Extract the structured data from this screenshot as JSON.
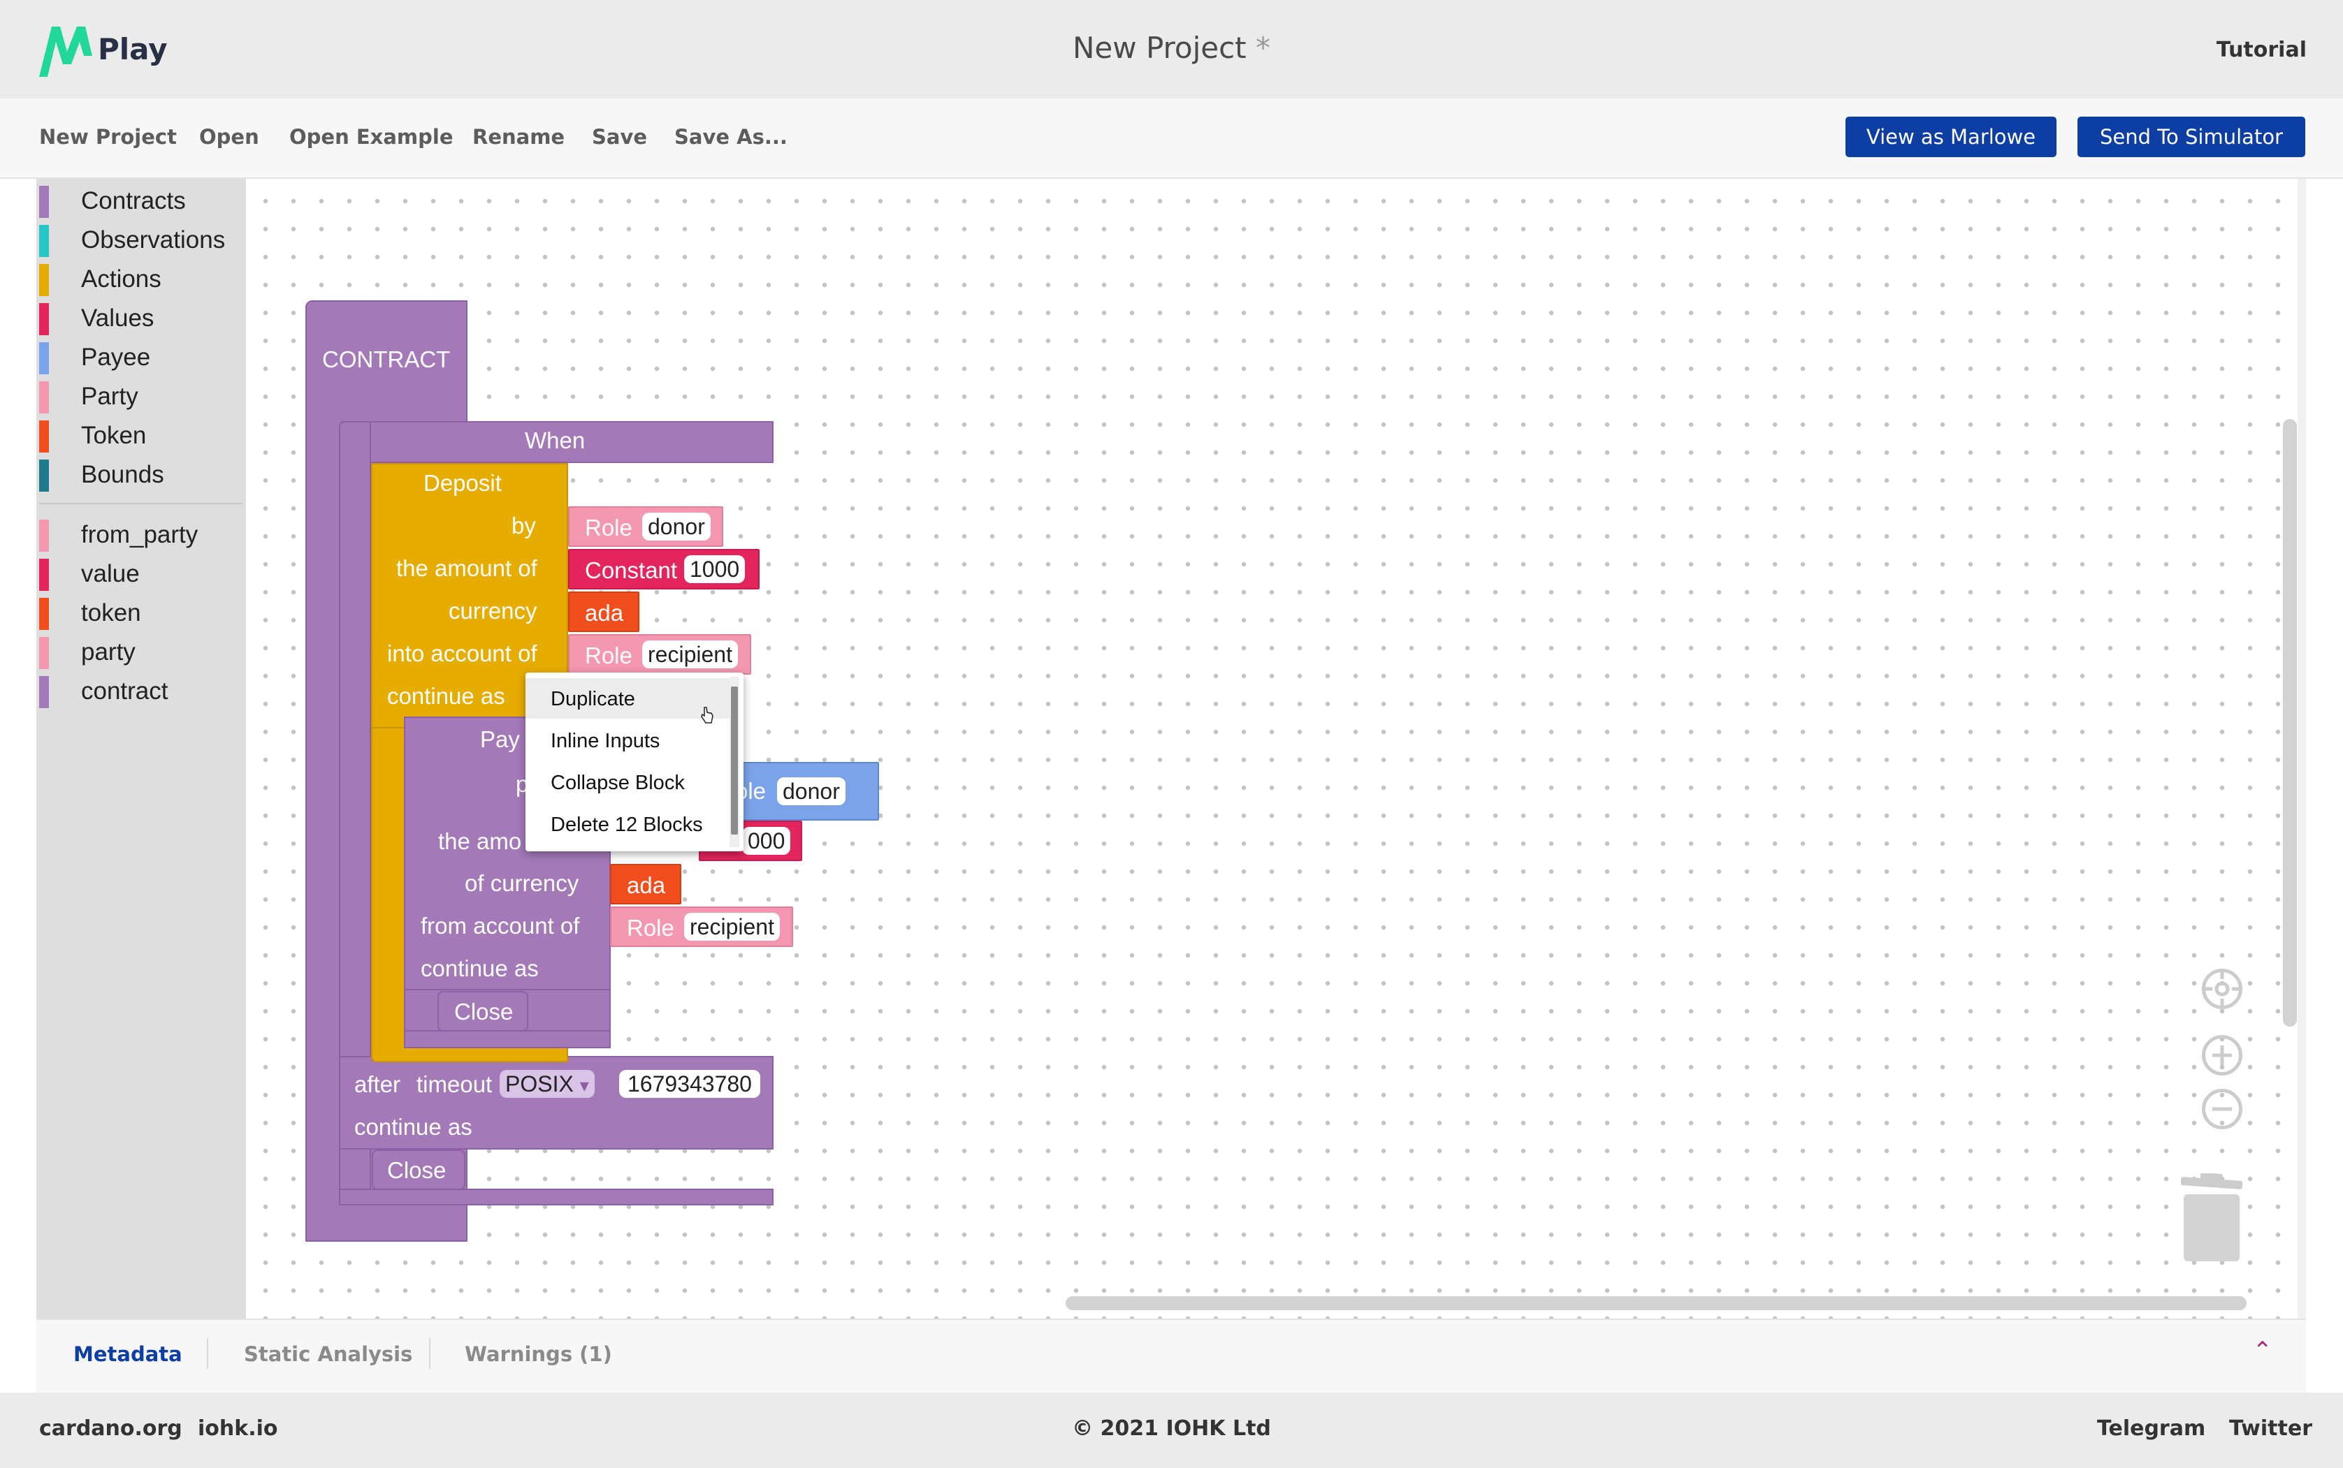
{
  "header": {
    "logo_text": "Play",
    "title": "New Project",
    "unsaved_marker": "*",
    "tutorial": "Tutorial"
  },
  "toolbar": {
    "new_project": "New Project",
    "open": "Open",
    "open_example": "Open Example",
    "rename": "Rename",
    "save": "Save",
    "save_as": "Save As...",
    "view_as_marlowe": "View as Marlowe",
    "send_to_simulator": "Send To Simulator",
    "button_color": "#0c3ea3"
  },
  "toolbox": {
    "categories": [
      {
        "label": "Contracts",
        "color": "#a379b8"
      },
      {
        "label": "Observations",
        "color": "#26c6c6"
      },
      {
        "label": "Actions",
        "color": "#e6ac00"
      },
      {
        "label": "Values",
        "color": "#e3245d"
      },
      {
        "label": "Payee",
        "color": "#7aa3ea"
      },
      {
        "label": "Party",
        "color": "#f497b0"
      },
      {
        "label": "Token",
        "color": "#f14e1d"
      },
      {
        "label": "Bounds",
        "color": "#1f7a8c"
      }
    ],
    "holes": [
      {
        "label": "from_party",
        "color": "#f497b0"
      },
      {
        "label": "value",
        "color": "#e3245d"
      },
      {
        "label": "token",
        "color": "#f14e1d"
      },
      {
        "label": "party",
        "color": "#f497b0"
      },
      {
        "label": "contract",
        "color": "#a379b8"
      }
    ]
  },
  "blocks": {
    "contract": "CONTRACT",
    "when": "When",
    "deposit": {
      "title": "Deposit",
      "by": "by",
      "amount": "the amount of",
      "currency": "currency",
      "into_account": "into account of",
      "continue_as": "continue as",
      "by_role": "Role",
      "by_role_name": "donor",
      "constant": "Constant",
      "constant_value": "1000",
      "currency_value": "ada",
      "into_role": "Role",
      "into_role_name": "recipient"
    },
    "pay": {
      "title": "Pay",
      "payee_partial": "p",
      "payee_role_partial": "ole",
      "payee_role_name": "donor",
      "amount_partial": "the amo",
      "amount_value_partial": "000",
      "of_currency": "of currency",
      "currency_value": "ada",
      "from_account": "from account of",
      "from_role": "Role",
      "from_role_name": "recipient",
      "continue_as": "continue as",
      "close": "Close"
    },
    "timeout": {
      "after": "after",
      "timeout": "timeout",
      "posix": "POSIX",
      "dropdown_arrow": "▾",
      "value": "1679343780",
      "continue_as": "continue as",
      "close": "Close"
    }
  },
  "context_menu": {
    "items": [
      "Duplicate",
      "Inline Inputs",
      "Collapse Block",
      "Delete 12 Blocks"
    ]
  },
  "bottom_panel": {
    "tabs": [
      "Metadata",
      "Static Analysis",
      "Warnings (1)"
    ],
    "active_tab": "Metadata",
    "active_color": "#0c3ea3",
    "chevron": "⌃"
  },
  "footer": {
    "cardano": "cardano.org",
    "iohk": "iohk.io",
    "copyright": "© 2021 IOHK Ltd",
    "telegram": "Telegram",
    "twitter": "Twitter"
  }
}
